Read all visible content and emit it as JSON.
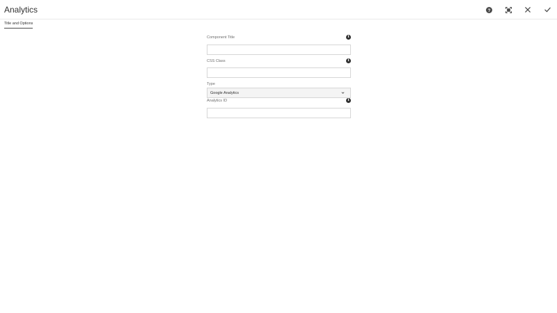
{
  "header": {
    "title": "Analytics",
    "actions": {
      "help_icon": "help-icon",
      "fullscreen_icon": "fullscreen-icon",
      "close_icon": "close-icon",
      "done_icon": "check-icon"
    }
  },
  "tabs": [
    {
      "label": "Title and Options",
      "active": true
    }
  ],
  "form": {
    "component_title": {
      "label": "Component Title",
      "value": "",
      "info_icon": "info-icon"
    },
    "css_class": {
      "label": "CSS Class",
      "value": "",
      "info_icon": "info-icon"
    },
    "type": {
      "label": "Type",
      "selected": "Google Analytics"
    },
    "analytics_id": {
      "label": "Analytics ID",
      "value": "",
      "info_icon": "info-icon"
    }
  }
}
